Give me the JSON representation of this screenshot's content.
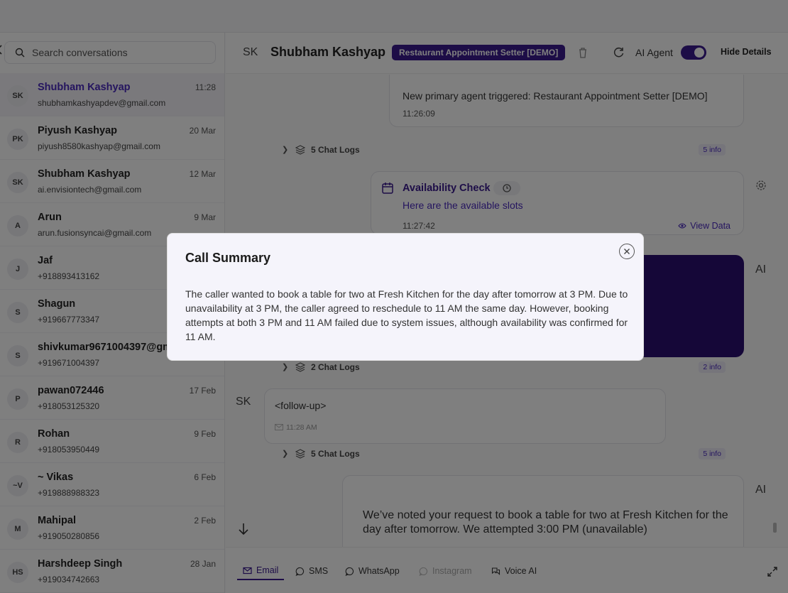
{
  "search": {
    "placeholder": "Search conversations"
  },
  "conversations": [
    {
      "initials": "SK",
      "name": "Shubham Kashyap",
      "sub": "shubhamkashyapdev@gmail.com",
      "time": "11:28",
      "active": true
    },
    {
      "initials": "PK",
      "name": "Piyush Kashyap",
      "sub": "piyush8580kashyap@gmail.com",
      "time": "20 Mar"
    },
    {
      "initials": "SK",
      "name": "Shubham Kashyap",
      "sub": "ai.envisiontech@gmail.com",
      "time": "12 Mar"
    },
    {
      "initials": "A",
      "name": "Arun",
      "sub": "arun.fusionsyncai@gmail.com",
      "time": "9 Mar"
    },
    {
      "initials": "J",
      "name": "Jaf",
      "sub": "+918893413162",
      "time": ""
    },
    {
      "initials": "S",
      "name": "Shagun",
      "sub": "+919667773347",
      "time": ""
    },
    {
      "initials": "S",
      "name": "shivkumar9671004397@gmail.com",
      "sub": "+919671004397",
      "time": ""
    },
    {
      "initials": "P",
      "name": "pawan072446",
      "sub": "+918053125320",
      "time": "17 Feb"
    },
    {
      "initials": "R",
      "name": "Rohan",
      "sub": "+918053950449",
      "time": "9 Feb"
    },
    {
      "initials": "~V",
      "name": "~ Vikas",
      "sub": "+919888988323",
      "time": "6 Feb"
    },
    {
      "initials": "M",
      "name": "Mahipal",
      "sub": "+919050280856",
      "time": "2 Feb"
    },
    {
      "initials": "HS",
      "name": "Harshdeep Singh",
      "sub": "+919034742663",
      "time": "28 Jan"
    }
  ],
  "header": {
    "initials": "SK",
    "name": "Shubham Kashyap",
    "badge": "Restaurant Appointment Setter [DEMO]",
    "ai_agent_label": "AI Agent",
    "ai_agent_enabled": true,
    "hide_details": "Hide Details"
  },
  "chat": {
    "system_message": "New primary agent triggered: Restaurant Appointment Setter [DEMO]",
    "system_time": "11:26:09",
    "log1": {
      "label": "5 Chat Logs",
      "info": "5 info"
    },
    "availability": {
      "title": "Availability Check",
      "subtitle": "Here are the available slots",
      "time": "11:27:42",
      "view_data": "View Data"
    },
    "ai_label": "AI",
    "log2": {
      "label": "2 Chat Logs",
      "info": "2 info"
    },
    "user_initials": "SK",
    "followup_text": "<follow-up>",
    "followup_time": "11:28 AM",
    "log3": {
      "label": "5 Chat Logs",
      "info": "5 info"
    },
    "reply_text": "We’ve noted your request to book a table for two at Fresh Kitchen for the day after tomorrow. We attempted 3:00 PM (unavailable)"
  },
  "tabs": [
    {
      "label": "Email",
      "icon": "mail-icon",
      "active": true
    },
    {
      "label": "SMS",
      "icon": "chat-bubble-icon"
    },
    {
      "label": "WhatsApp",
      "icon": "whatsapp-icon"
    },
    {
      "label": "Instagram",
      "icon": "instagram-icon",
      "disabled": true
    },
    {
      "label": "Voice AI",
      "icon": "voice-ai-icon"
    }
  ],
  "modal": {
    "title": "Call Summary",
    "body": "The caller wanted to book a table for two at Fresh Kitchen for the day after tomorrow at 3 PM. Due to unavailability at 3 PM, the caller agreed to reschedule to 11 AM the same day. However, booking attempts at both 3 PM and 11 AM failed due to system issues, although availability was confirmed for 11 AM."
  },
  "colors": {
    "accent": "#3a1a8f",
    "accent_dark": "#2a0f70",
    "overlay": "rgba(0,0,0,0.5)"
  }
}
